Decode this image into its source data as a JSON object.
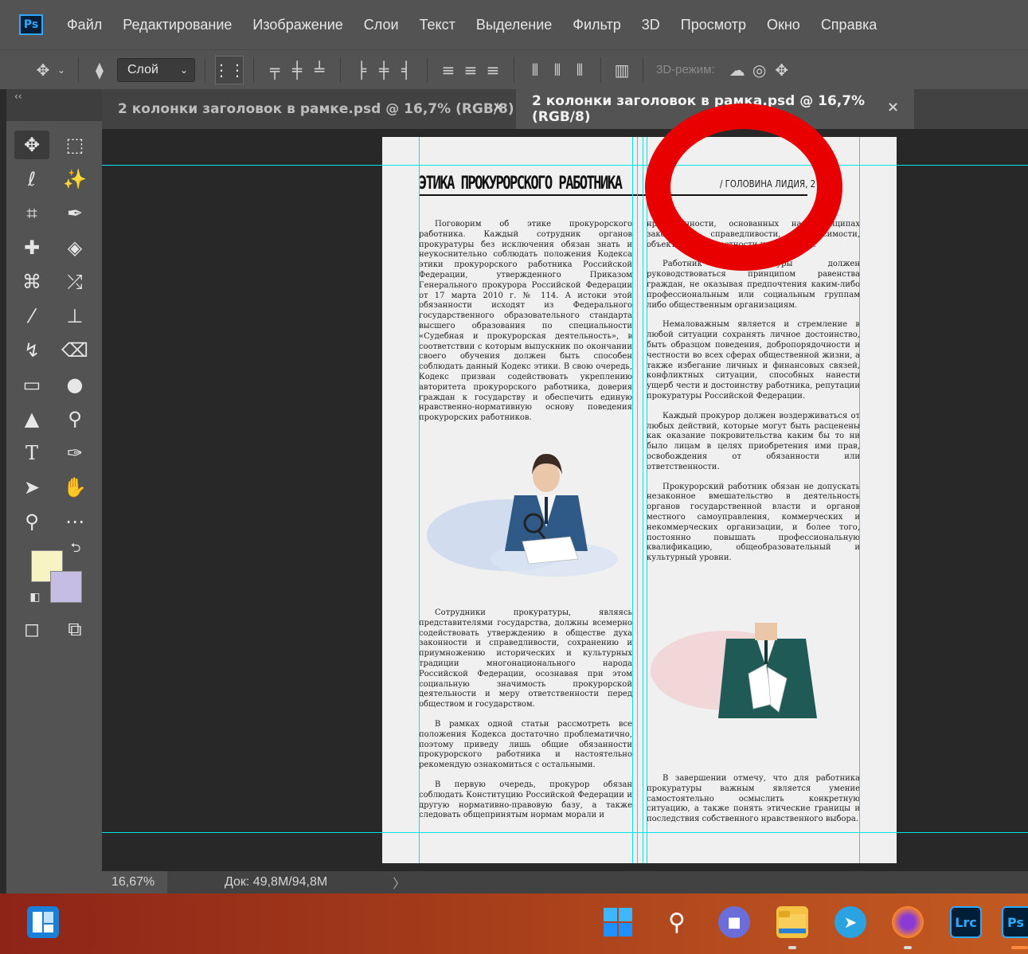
{
  "app": {
    "logo": "Ps"
  },
  "menu": [
    "Файл",
    "Редактирование",
    "Изображение",
    "Слои",
    "Текст",
    "Выделение",
    "Фильтр",
    "3D",
    "Просмотр",
    "Окно",
    "Справка"
  ],
  "options": {
    "layer_select": "Слой",
    "mode_3d": "3D-режим:"
  },
  "panel": {
    "collapse": "‹‹"
  },
  "tabs": [
    {
      "label": "2 колонки заголовок в рамке.psd @ 16,7% (RGB/8)",
      "close": "×"
    },
    {
      "label": "2 колонки заголовок в рамка.psd @ 16,7% (RGB/8)",
      "close": "×"
    }
  ],
  "document": {
    "title": "ЭТИКА ПРОКУРОРСКОГО РАБОТНИКА",
    "subtitle": "/ ГОЛОВИНА ЛИДИЯ, 2 КУРС",
    "left_column_top": [
      "Поговорим об этике прокурорского работника. Каждый сотрудник органов прокуратуры без исключения обязан знать и неукоснительно соблюдать положения Кодекса этики прокурорского работника Российской Федерации, утвержденного Приказом Генерального прокурора Российской Федерации от 17 марта 2010 г. № 114. А истоки этой обязанности исходят из Федерального государственного образовательного стандарта высшего образования по специальности «Судебная и прокурорская деятельность», в соответствии с которым выпускник по окончании своего обучения должен быть способен соблюдать данный Кодекс этики. В свою очередь, Кодекс призван содействовать укреплению авторитета прокурорского работника, доверия граждан к государству и обеспечить единую нравственно-нормативную основу поведения прокурорских работников."
    ],
    "left_column_bottom": [
      "Сотрудники прокуратуры, являясь представителями государства, должны всемерно содействовать утверждению в обществе духа законности и справедливости, сохранению и приумножению исторических и культурных традиции многонационального народа Российской Федерации, осознавая при этом социальную значимость прокурорской деятельности и меру ответственности перед обществом и государством.",
      "В рамках одной статьи рассмотреть все положения Кодекса достаточно проблематично, поэтому приведу лишь общие обязанности прокурорского работника и настоятельно рекомендую ознакомиться с остальными.",
      "В первую очередь, прокурор обязан соблюдать Конституцию Российской Федерации и другую нормативно-правовую базу, а также следовать общепринятым нормам морали и"
    ],
    "right_column_top": [
      "нравственности, основанных на принципах законности, справедливости, независимости, объективности, честности и гуманизма.",
      "Работник прокуратуры должен руководствоваться принципом равенства граждан, не оказывая предпочтения каким-либо профессиональным или социальным группам либо общественным организациям.",
      "Немаловажным является и стремление в любой ситуации сохранять личное достоинство, быть образцом поведения, добропорядочности и честности во всех сферах общественной жизни, а также избегание личных и финансовых связей, конфликтных ситуации, способных нанести ущерб чести и достоинству работника, репутации прокуратуры Российской Федерации.",
      "Каждый прокурор должен воздерживаться от любых действий, которые могут быть расценены как оказание покровительства каким бы то ни было лицам в целях приобретения ими прав, освобождения от обязанности или ответственности.",
      "Прокурорский работник обязан не допускать незаконное вмешательство в деятельность органов государственной власти и органов местного самоуправления, коммерческих и некоммерческих организации, и более того, постоянно повышать профессиональную квалификацию, общеобразовательный и культурный уровни."
    ],
    "right_column_bottom": [
      "В завершении отмечу, что для работника прокуратуры важным является умение самостоятельно осмыслить конкретную ситуацию, а также понять этические границы и последствия собственного нравственного выбора."
    ]
  },
  "status": {
    "zoom": "16,67%",
    "doc_size": "Док: 49,8M/94,8M",
    "arrow": "〉"
  },
  "taskbar": {
    "lrc": "Lrc",
    "ps": "Ps"
  },
  "colors": {
    "foreground": "#f7f3c2",
    "background": "#c6bde4",
    "guide": "#00e5e5",
    "annotation": "#e80000"
  },
  "icons": [
    "move-icon",
    "marquee-icon",
    "lasso-icon",
    "magic-wand-icon",
    "crop-icon",
    "eyedropper-icon",
    "healing-icon",
    "patch-icon",
    "stamp-icon",
    "brush-icon",
    "eraser-icon",
    "gradient-icon",
    "blur-icon",
    "text-icon",
    "pen-icon",
    "selection-icon",
    "hand-icon",
    "zoom-icon",
    "more-icon"
  ]
}
